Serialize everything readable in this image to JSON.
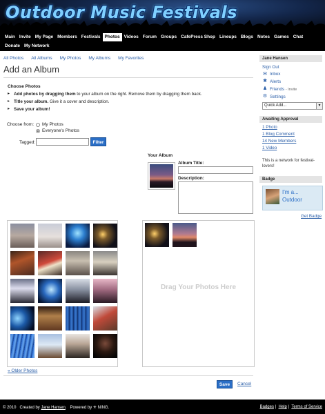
{
  "site": {
    "title": "Outdoor Music Festivals"
  },
  "nav": {
    "row1": [
      "Main",
      "Invite",
      "My Page",
      "Members",
      "Festivals",
      "Photos",
      "Videos",
      "Forum",
      "Groups",
      "CafePress Shop",
      "Lineups",
      "Blogs",
      "Notes",
      "Games",
      "Chat"
    ],
    "row2": [
      "Donate",
      "My Network"
    ],
    "active": "Photos"
  },
  "subnav": [
    "All Photos",
    "All Albums",
    "My Photos",
    "My Albums",
    "My Favorites"
  ],
  "page_title": "Add an Album",
  "choose_photos": {
    "heading": "Choose Photos",
    "steps": [
      {
        "bold": "Add photos by dragging them",
        "rest": " to your album on the right. Remove them by dragging them back."
      },
      {
        "bold": "Title your album.",
        "rest": " Give it a cover and description."
      },
      {
        "bold": "Save your album!",
        "rest": ""
      }
    ]
  },
  "filter": {
    "choose_from_label": "Choose from:",
    "options": [
      "My Photos",
      "Everyone's Photos"
    ],
    "selected_index": 1,
    "tagged_label": "Tagged:",
    "tagged_value": "",
    "filter_button": "Filter"
  },
  "album": {
    "heading": "Your Album",
    "title_label": "Album Title:",
    "title_value": "",
    "description_label": "Description:",
    "description_value": "",
    "drop_hint": "Drag Your Photos Here"
  },
  "source_photos": [
    "crowd-sunset",
    "hazy-crowd",
    "blue-stage-lights",
    "night-stage",
    "red-shirt-performer",
    "guitarist-stage",
    "band-onstage",
    "dj-stage",
    "crowd-hands-up",
    "blue-light-beams",
    "crowd-raised-arms",
    "pink-crowd",
    "blue-rays",
    "audience-faces",
    "blue-seats",
    "guitarist-red",
    "blue-stadium",
    "hands-peace",
    "microphone-singer",
    "dark-concert"
  ],
  "album_photos": [
    "night-stage",
    "sunset-crowd"
  ],
  "links": {
    "older_photos": "« Older Photos",
    "cancel": "Cancel"
  },
  "save_button": "Save",
  "sidebar": {
    "user": "Jane Hansen",
    "sign_out": "Sign Out",
    "inbox": "Inbox",
    "alerts": "Alerts",
    "friends": "Friends",
    "invite": "- Invite",
    "settings": "Settings",
    "quick_add": "Quick Add...",
    "awaiting_heading": "Awaiting Approval",
    "awaiting": [
      "1 Photo",
      "1 Blog Comment",
      "14 New Members",
      "1 Video"
    ],
    "network_note": "This is a network for festival-lovers!",
    "badge_heading": "Badge",
    "badge_text1": "I'm a...",
    "badge_text2": "Outdoor",
    "get_badge": "Get Badge"
  },
  "footer": {
    "copyright": "© 2010",
    "created_by": "Created by",
    "creator": "Jane Hansen",
    "powered_by": "Powered by",
    "ning": "NING.",
    "links": [
      "Badges",
      "Help",
      "Terms of Service"
    ]
  },
  "colors": {
    "link": "#2a5ea8",
    "button": "#2a6ec6",
    "nav_bg": "#000000"
  }
}
